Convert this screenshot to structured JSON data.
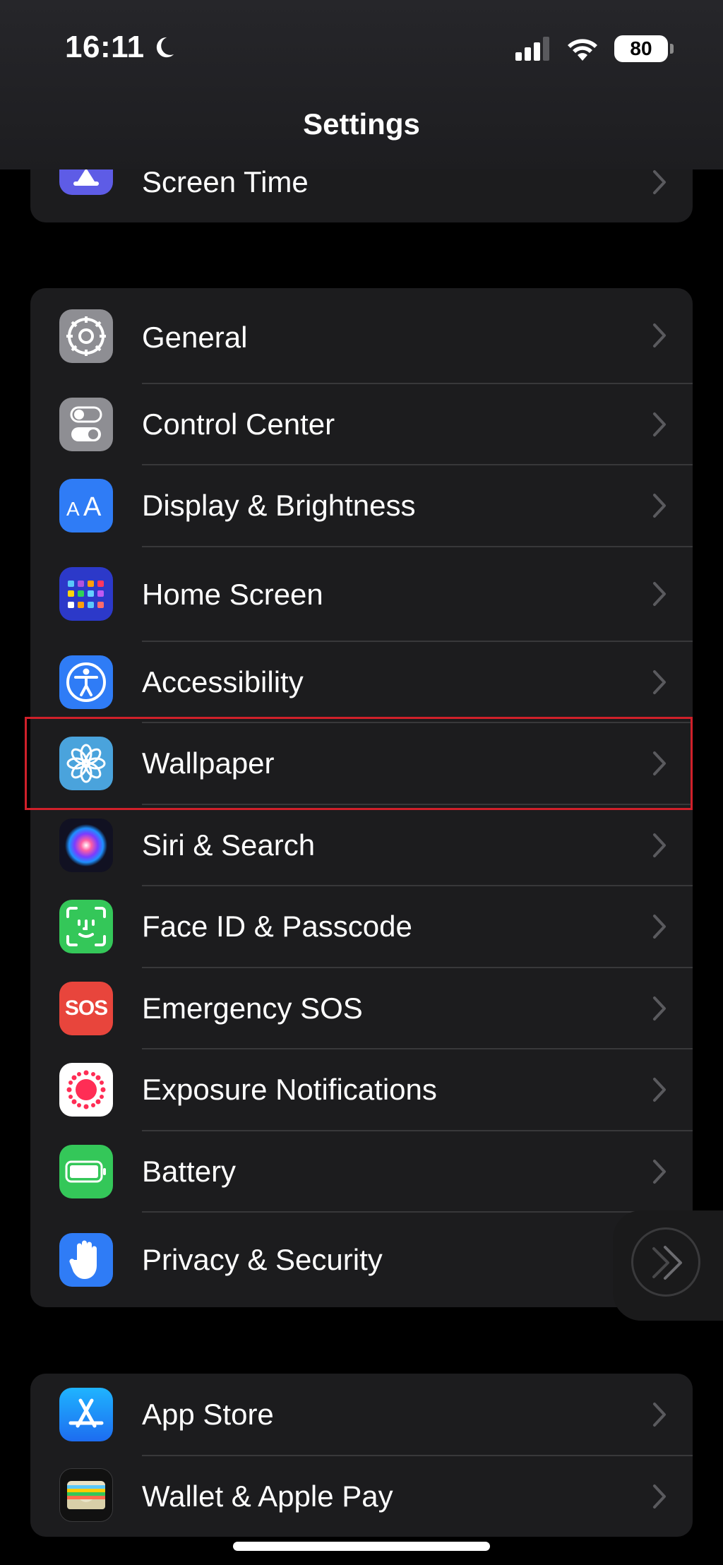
{
  "status": {
    "time": "16:11",
    "battery": "80"
  },
  "nav": {
    "title": "Settings"
  },
  "groups": [
    {
      "items": [
        {
          "label": "Screen Time",
          "icon": "hourglass-icon",
          "color": "#5e5ce6"
        }
      ]
    },
    {
      "items": [
        {
          "label": "General",
          "icon": "gear-icon",
          "color": "#8e8e93"
        },
        {
          "label": "Control Center",
          "icon": "toggle-switches-icon",
          "color": "#8e8e93"
        },
        {
          "label": "Display & Brightness",
          "icon": "text-size-icon",
          "color": "#2f7cf6"
        },
        {
          "label": "Home Screen",
          "icon": "app-grid-icon",
          "color": "#2c39c9"
        },
        {
          "label": "Accessibility",
          "icon": "accessibility-person-icon",
          "color": "#2f7cf6"
        },
        {
          "label": "Wallpaper",
          "icon": "flower-icon",
          "color": "#4aa3dc"
        },
        {
          "label": "Siri & Search",
          "icon": "siri-icon",
          "color": "#1a1a2e"
        },
        {
          "label": "Face ID & Passcode",
          "icon": "face-id-icon",
          "color": "#34c759"
        },
        {
          "label": "Emergency SOS",
          "icon": "sos-icon",
          "color": "#e8453c",
          "icon_text": "SOS"
        },
        {
          "label": "Exposure Notifications",
          "icon": "exposure-notifications-icon",
          "color": "#ffffff"
        },
        {
          "label": "Battery",
          "icon": "battery-icon",
          "color": "#34c759"
        },
        {
          "label": "Privacy & Security",
          "icon": "hand-icon",
          "color": "#2f7cf6"
        }
      ]
    },
    {
      "items": [
        {
          "label": "App Store",
          "icon": "app-store-icon",
          "color": "#1e8cf5"
        },
        {
          "label": "Wallet & Apple Pay",
          "icon": "wallet-icon",
          "color": "#1c1c1e"
        }
      ]
    }
  ]
}
